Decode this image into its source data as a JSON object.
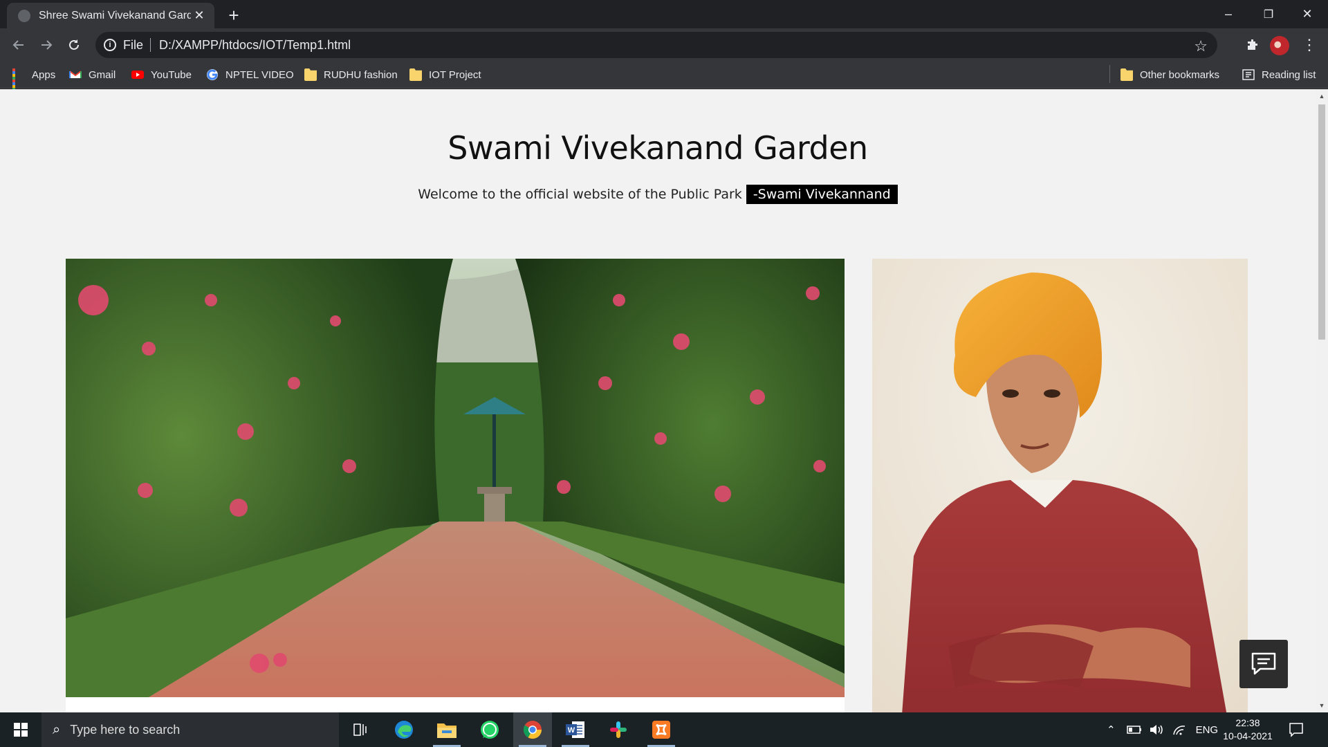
{
  "browser": {
    "tab_title": "Shree Swami Vivekanand Garden",
    "tab_close": "✕",
    "new_tab": "+",
    "window_controls": {
      "minimize": "–",
      "restore": "❐",
      "close": "✕"
    },
    "url_scheme": "File",
    "url": "D:/XAMPP/htdocs/IOT/Temp1.html",
    "bookmarks": [
      {
        "label": "Apps",
        "icon": "apps-grid-icon"
      },
      {
        "label": "Gmail",
        "icon": "gmail-icon"
      },
      {
        "label": "YouTube",
        "icon": "youtube-icon"
      },
      {
        "label": "NPTEL VIDEO",
        "icon": "google-icon"
      },
      {
        "label": "RUDHU fashion",
        "icon": "folder-icon"
      },
      {
        "label": "IOT Project",
        "icon": "folder-icon"
      }
    ],
    "other_bookmarks": "Other bookmarks",
    "reading_list": "Reading list"
  },
  "page": {
    "title": "Swami Vivekanand Garden",
    "subtitle": "Welcome to the official website of the Public Park",
    "tag": "-Swami Vivekannand",
    "images": [
      {
        "name": "garden-photo",
        "description_icon": "garden-path-image"
      },
      {
        "name": "portrait-photo",
        "description_icon": "portrait-image"
      }
    ]
  },
  "taskbar": {
    "search_placeholder": "Type here to search",
    "apps": [
      "task-view",
      "edge",
      "file-explorer",
      "whatsapp",
      "chrome",
      "word",
      "slack",
      "xampp"
    ],
    "active_app": "chrome",
    "language": "ENG",
    "time": "22:38",
    "date": "10-04-2021"
  },
  "colors": {
    "chrome_dark": "#202124",
    "chrome_toolbar": "#35363a",
    "page_bg": "#f2f2f2",
    "tag_bg": "#000000",
    "taskbar_bg": "#1b2226"
  }
}
